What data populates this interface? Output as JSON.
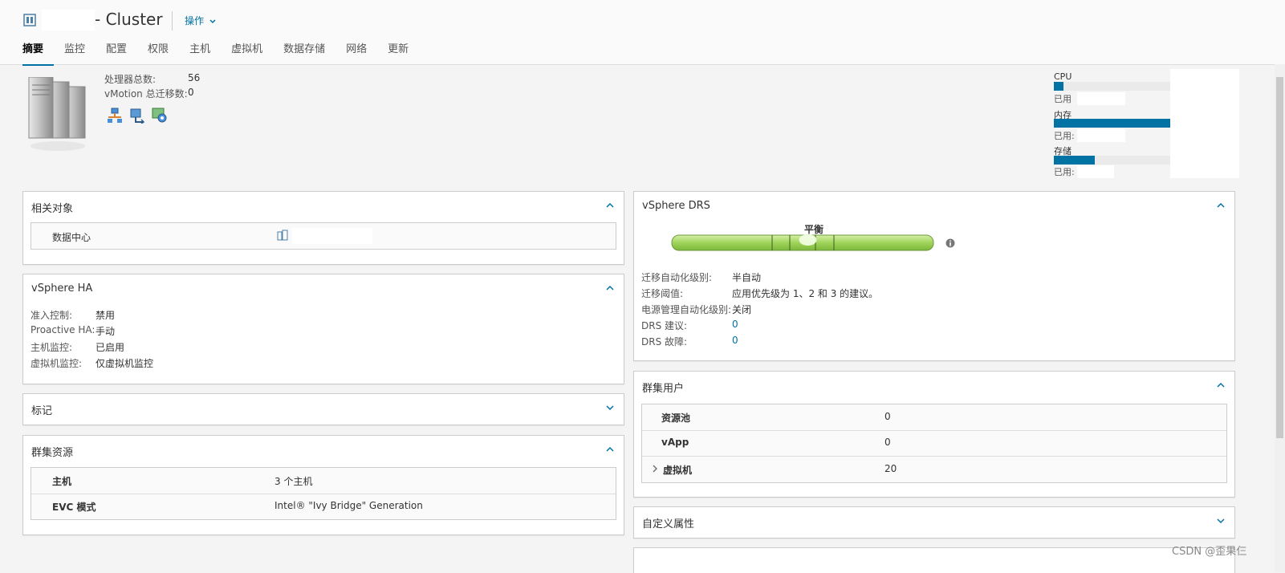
{
  "header": {
    "title": "- Cluster",
    "actions_label": "操作"
  },
  "tabs": [
    {
      "label": "摘要",
      "active": true
    },
    {
      "label": "监控"
    },
    {
      "label": "配置"
    },
    {
      "label": "权限"
    },
    {
      "label": "主机"
    },
    {
      "label": "虚拟机"
    },
    {
      "label": "数据存储"
    },
    {
      "label": "网络"
    },
    {
      "label": "更新"
    }
  ],
  "summary": {
    "cpu_total_label": "处理器总数:",
    "cpu_total_value": "56",
    "vmotion_label": "vMotion 总迁移数:",
    "vmotion_value": "0"
  },
  "resources": {
    "cpu_label": "CPU",
    "cpu_used_label": "已用",
    "cpu_used_fraction": 0.08,
    "mem_label": "内存",
    "mem_used_label": "已用:",
    "mem_used_fraction": 1.0,
    "storage_label": "存储",
    "storage_used_label": "已用:",
    "storage_used_fraction": 0.34
  },
  "related": {
    "title": "相关对象",
    "datacenter_label": "数据中心"
  },
  "ha": {
    "title": "vSphere HA",
    "rows": [
      {
        "label": "准入控制:",
        "value": "禁用"
      },
      {
        "label": "Proactive HA:",
        "value": "手动"
      },
      {
        "label": "主机监控:",
        "value": "已启用"
      },
      {
        "label": "虚拟机监控:",
        "value": "仅虚拟机监控"
      }
    ]
  },
  "tags": {
    "title": "标记"
  },
  "cluster_resources": {
    "title": "群集资源",
    "rows": [
      {
        "label": "主机",
        "value": "3 个主机"
      },
      {
        "label": "EVC 模式",
        "value": "Intel® \"Ivy Bridge\" Generation"
      }
    ]
  },
  "drs": {
    "title": "vSphere DRS",
    "balance_label": "平衡",
    "balance_marker_fraction": 0.52,
    "rows": [
      {
        "label": "迁移自动化级别:",
        "value": "半自动",
        "link": false
      },
      {
        "label": "迁移阈值:",
        "value": "应用优先级为 1、2 和 3 的建议。",
        "link": false
      },
      {
        "label": "电源管理自动化级别:",
        "value": "关闭",
        "link": false
      },
      {
        "label": "DRS 建议:",
        "value": "0",
        "link": true
      },
      {
        "label": "DRS 故障:",
        "value": "0",
        "link": true
      }
    ]
  },
  "cluster_users": {
    "title": "群集用户",
    "rows": [
      {
        "label": "资源池",
        "value": "0"
      },
      {
        "label": "vApp",
        "value": "0"
      },
      {
        "label": "虚拟机",
        "value": "20"
      }
    ]
  },
  "custom_attributes": {
    "title": "自定义属性"
  },
  "watermark": "CSDN @歪果仨",
  "colors": {
    "accent": "#0072a3",
    "drs_green": "#8fd14f"
  }
}
